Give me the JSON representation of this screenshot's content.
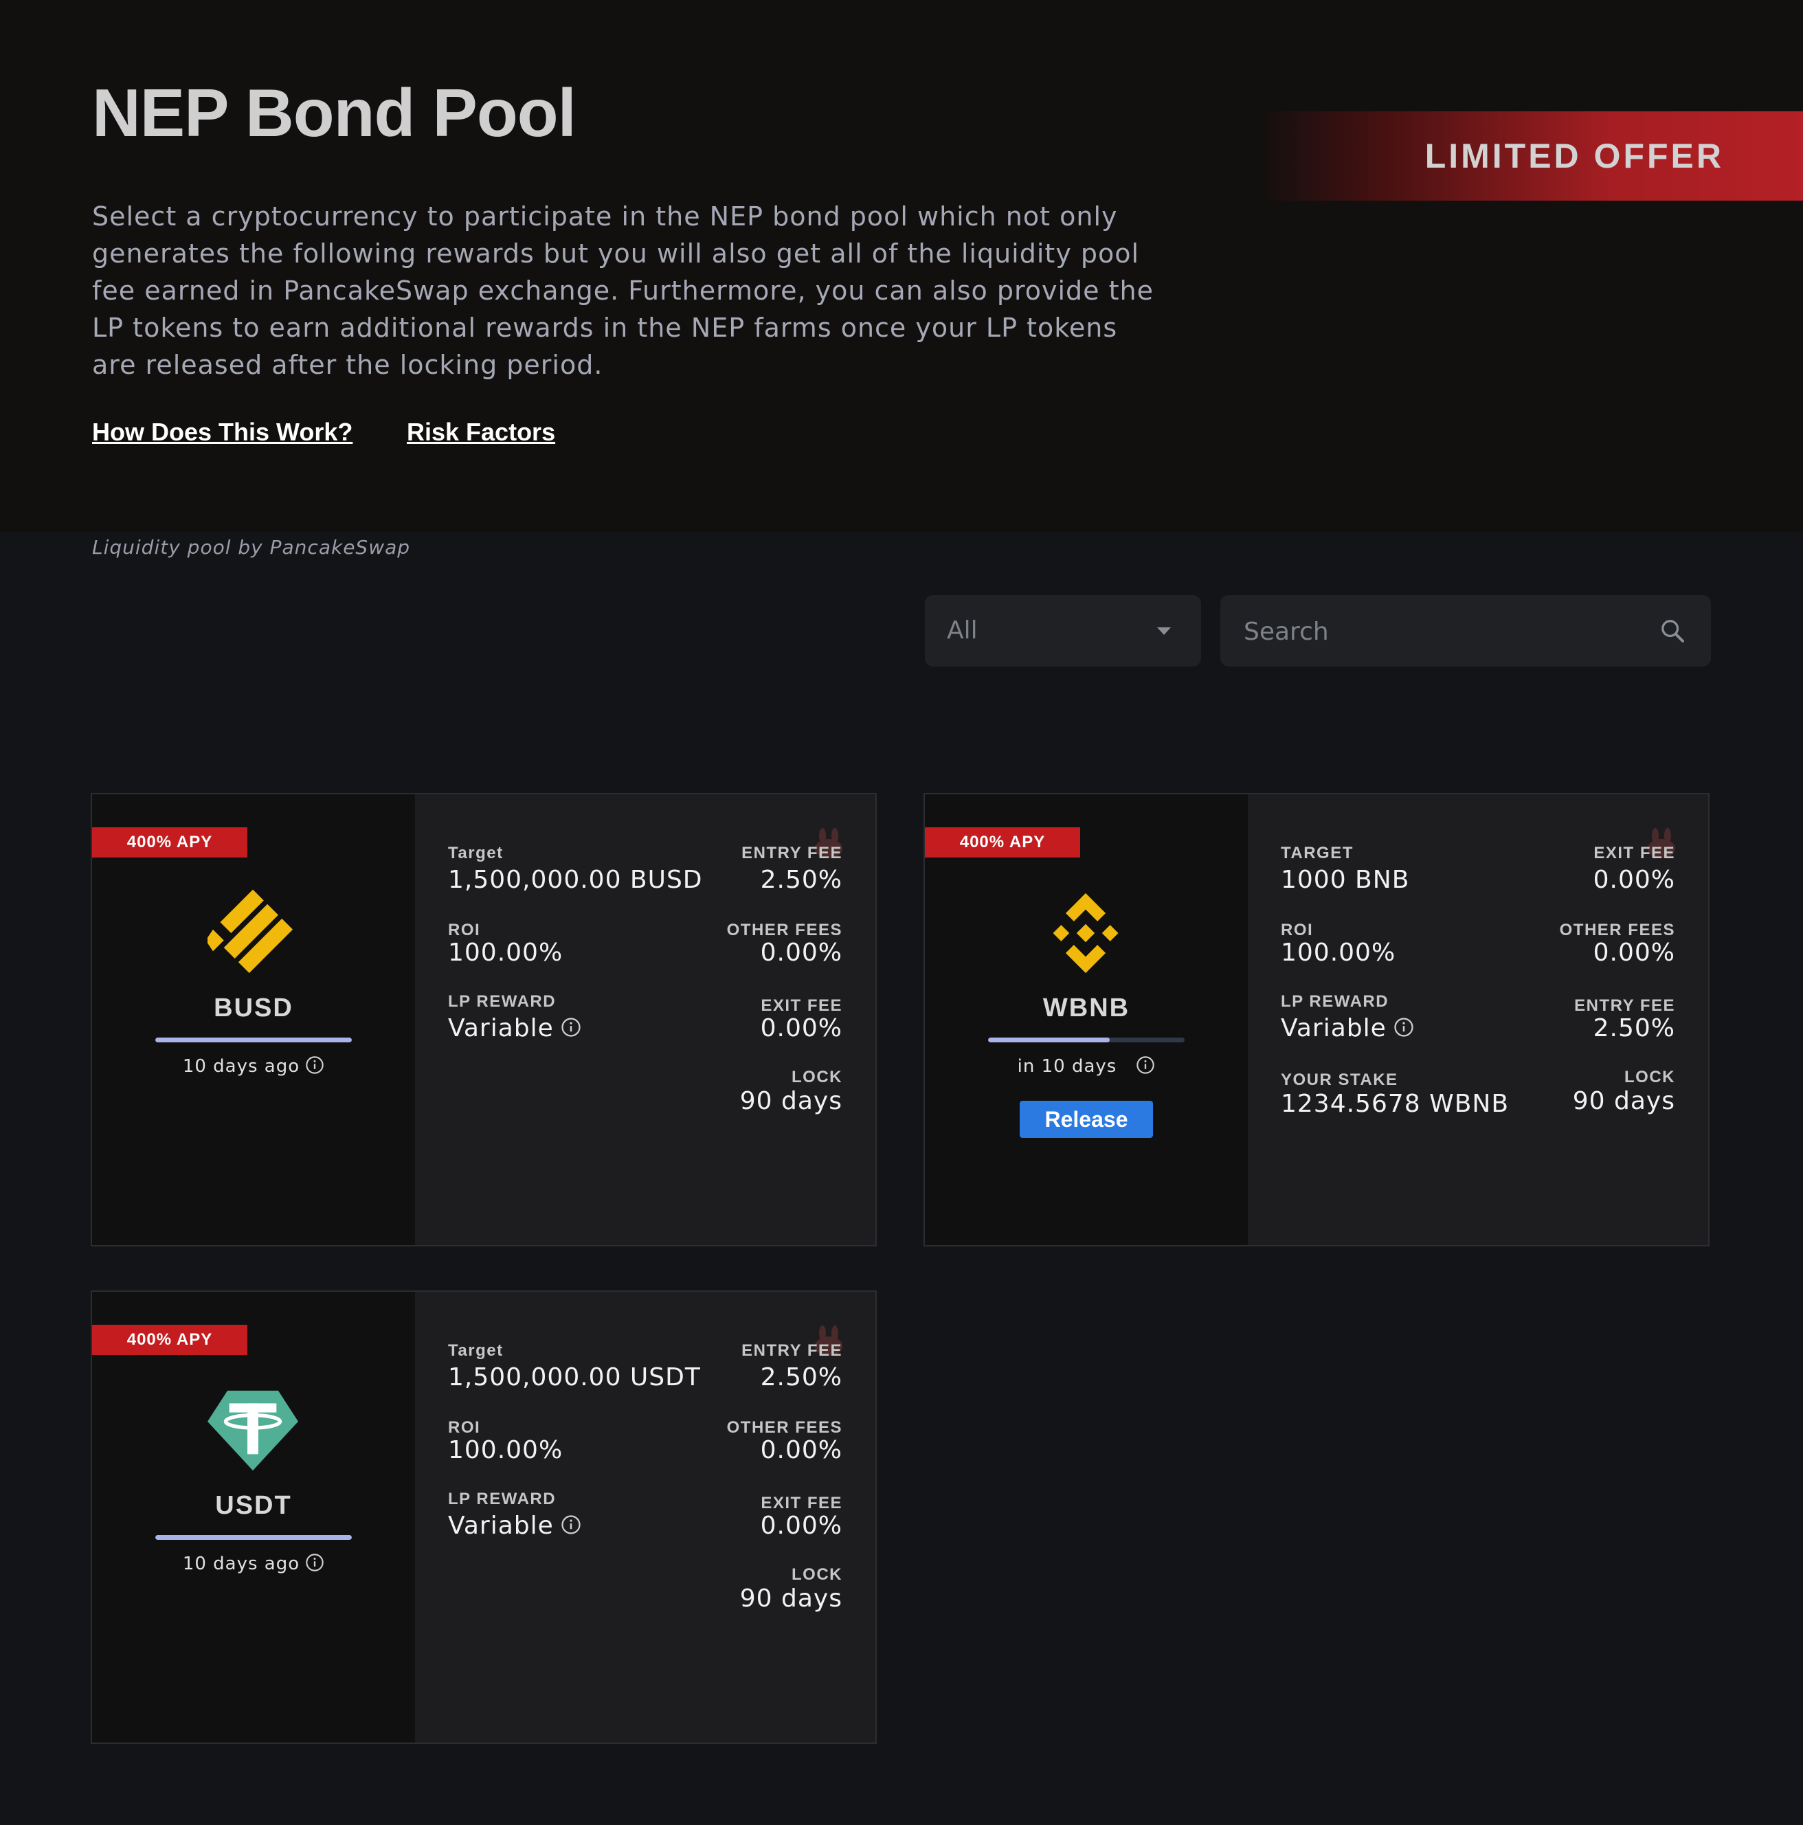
{
  "hero": {
    "title": "NEP Bond Pool",
    "description": "Select a cryptocurrency to participate in the NEP bond pool which not only generates the following rewards but you will also get all of the liquidity pool fee earned in PancakeSwap exchange. Furthermore, you can also provide the LP tokens to earn additional rewards in the NEP farms once your LP tokens are released after the locking period.",
    "links": [
      "How Does This Work?",
      "Risk Factors"
    ],
    "banner": "LIMITED OFFER"
  },
  "lp_note": "Liquidity pool by PancakeSwap",
  "filter": {
    "selected": "All"
  },
  "search": {
    "placeholder": "Search"
  },
  "colors": {
    "accent_red": "#c41c1f",
    "release_blue": "#2a7ae2",
    "progress": "#a9b5e8",
    "busd_yellow": "#f0b90b",
    "usdt_green": "#50af95"
  },
  "cards": [
    {
      "badge": "400% APY",
      "coin": "BUSD",
      "icon": "busd-logo-icon",
      "progress": 1.0,
      "time": "10 days ago",
      "left": [
        {
          "label": "Target",
          "value": "1,500,000.00 BUSD"
        },
        {
          "label": "ROI",
          "value": "100.00%"
        },
        {
          "label": "LP REWARD",
          "value": "Variable"
        }
      ],
      "right": [
        {
          "label": "ENTRY FEE",
          "value": "2.50%"
        },
        {
          "label": "OTHER FEES",
          "value": "0.00%"
        },
        {
          "label": "EXIT FEE",
          "value": "0.00%"
        },
        {
          "label": "LOCK",
          "value": "90 days"
        }
      ]
    },
    {
      "badge": "400% APY",
      "coin": "WBNB",
      "icon": "bnb-logo-icon",
      "progress": 0.62,
      "time": "in 10 days",
      "button": "Release",
      "left": [
        {
          "label": "TARGET",
          "value": "1000 BNB"
        },
        {
          "label": "ROI",
          "value": "100.00%"
        },
        {
          "label": "LP REWARD",
          "value": "Variable"
        },
        {
          "label": "YOUR STAKE",
          "value": "1234.5678 WBNB"
        }
      ],
      "right": [
        {
          "label": "EXIT FEE",
          "value": "0.00%"
        },
        {
          "label": "OTHER FEES",
          "value": "0.00%"
        },
        {
          "label": "ENTRY FEE",
          "value": "2.50%"
        },
        {
          "label": "LOCK",
          "value": "90 days"
        }
      ]
    },
    {
      "badge": "400% APY",
      "coin": "USDT",
      "icon": "usdt-logo-icon",
      "progress": 1.0,
      "time": "10 days ago",
      "left": [
        {
          "label": "Target",
          "value": "1,500,000.00 USDT"
        },
        {
          "label": "ROI",
          "value": "100.00%"
        },
        {
          "label": "LP REWARD",
          "value": "Variable"
        }
      ],
      "right": [
        {
          "label": "ENTRY FEE",
          "value": "2.50%"
        },
        {
          "label": "OTHER FEES",
          "value": "0.00%"
        },
        {
          "label": "EXIT FEE",
          "value": "0.00%"
        },
        {
          "label": "LOCK",
          "value": "90 days"
        }
      ]
    }
  ]
}
